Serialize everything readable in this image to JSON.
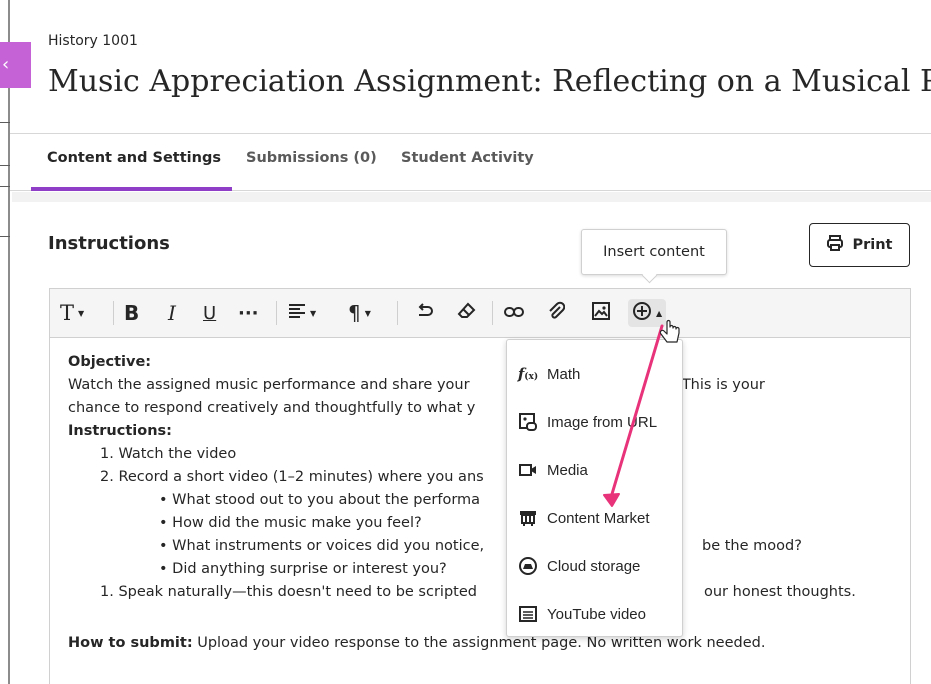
{
  "course": "History 1001",
  "title": "Music Appreciation Assignment: Reflecting on a Musical Performance",
  "tabs": [
    {
      "label": "Content and Settings"
    },
    {
      "label": "Submissions (0)"
    },
    {
      "label": "Student Activity"
    }
  ],
  "section_title": "Instructions",
  "print_label": "Print",
  "tooltip": "Insert content",
  "toolbar_icons": [
    "text-style-icon",
    "bold-icon",
    "italic-icon",
    "underline-icon",
    "more-formatting-icon",
    "align-icon",
    "paragraph-icon",
    "undo-icon",
    "clear-format-icon",
    "link-icon",
    "attachment-icon",
    "image-icon",
    "insert-content-icon"
  ],
  "content": {
    "objective_heading": "Objective:",
    "objective_l1a": "Watch the assigned music performance and share your",
    "objective_l1b": "n video! This is your",
    "objective_l2": "chance to respond creatively and thoughtfully to what y",
    "instructions_heading": "Instructions:",
    "step1": "1. Watch the video",
    "step2": "2. Record a short video (1–2 minutes) where you ans",
    "bullet1": "• What stood out to you about the performa",
    "bullet2": "• How did the music make you feel?",
    "bullet3a": "• What instruments or voices did you notice,",
    "bullet3b": "be the mood?",
    "bullet4": "• Did anything surprise or interest you?",
    "step3a": "1. Speak naturally—this doesn't need to be scripted",
    "step3b": "our honest thoughts.",
    "submit_label": "How to submit:",
    "submit_text": " Upload your video response to the assignment page. No written work needed."
  },
  "menu": [
    {
      "label": "Math",
      "icon": "math-icon"
    },
    {
      "label": "Image from URL",
      "icon": "image-url-icon"
    },
    {
      "label": "Media",
      "icon": "media-icon"
    },
    {
      "label": "Content Market",
      "icon": "content-market-icon"
    },
    {
      "label": "Cloud storage",
      "icon": "cloud-storage-icon"
    },
    {
      "label": "YouTube video",
      "icon": "youtube-video-icon"
    }
  ],
  "colors": {
    "accent": "#8f3fc7",
    "collapse": "#c563d6",
    "annotation_arrow": "#e8327a"
  }
}
